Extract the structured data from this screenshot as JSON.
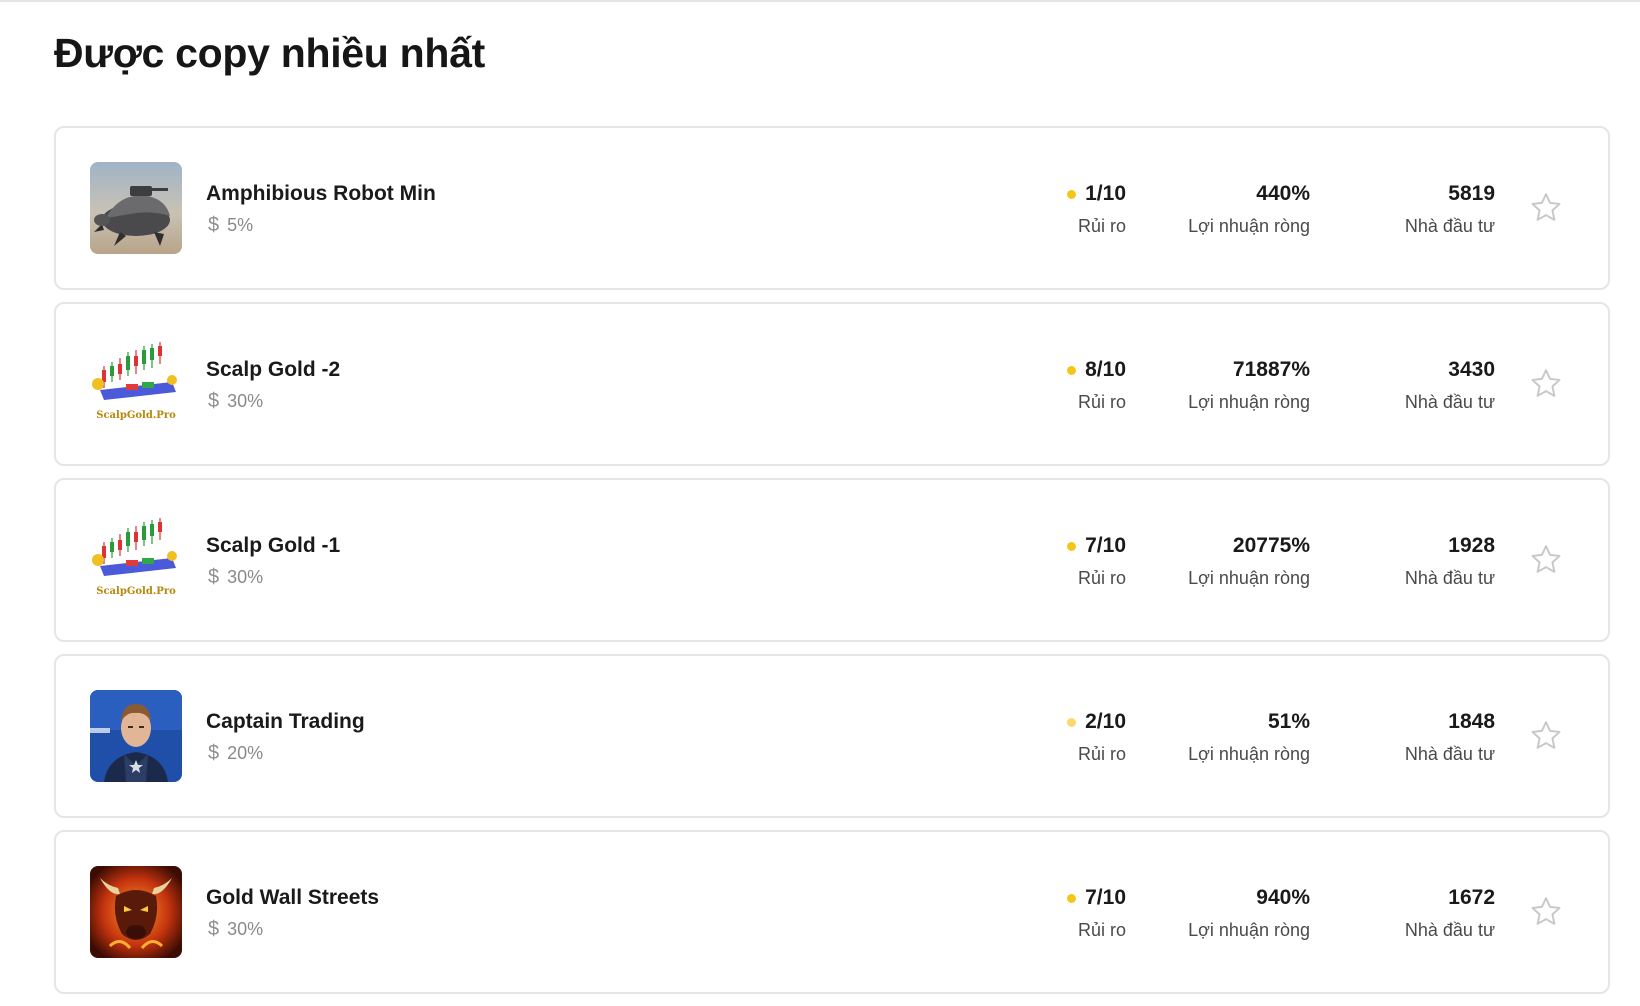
{
  "page": {
    "title": "Được copy nhiều nhất"
  },
  "labels": {
    "risk": "Rủi ro",
    "profit": "Lợi nhuận ròng",
    "investors": "Nhà đầu tư"
  },
  "colors": {
    "risk_dot": "#f5c518",
    "risk_dot_light": "#f8d96a"
  },
  "traders": [
    {
      "name": "Amphibious Robot Min",
      "fee": "5%",
      "risk": "1/10",
      "profit": "440%",
      "investors": "5819",
      "avatar_icon": "robot-turtle-image"
    },
    {
      "name": "Scalp Gold -2",
      "fee": "30%",
      "risk": "8/10",
      "profit": "71887%",
      "investors": "3430",
      "avatar_icon": "scalpgold-logo",
      "avatar_text": "ScalpGold.Pro"
    },
    {
      "name": "Scalp Gold -1",
      "fee": "30%",
      "risk": "7/10",
      "profit": "20775%",
      "investors": "1928",
      "avatar_icon": "scalpgold-logo",
      "avatar_text": "ScalpGold.Pro"
    },
    {
      "name": "Captain Trading",
      "fee": "20%",
      "risk": "2/10",
      "profit": "51%",
      "investors": "1848",
      "avatar_icon": "captain-portrait-image"
    },
    {
      "name": "Gold Wall Streets",
      "fee": "30%",
      "risk": "7/10",
      "profit": "940%",
      "investors": "1672",
      "avatar_icon": "fire-bull-image"
    }
  ]
}
